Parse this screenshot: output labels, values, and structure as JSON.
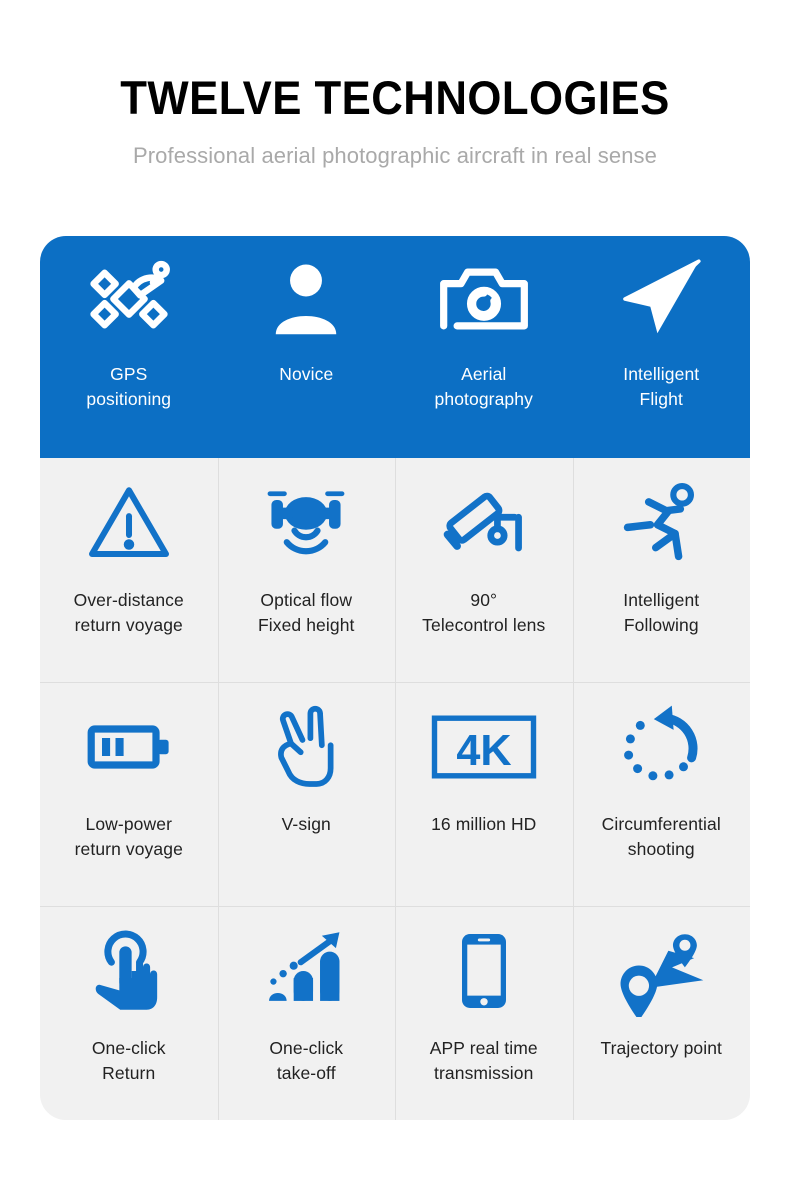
{
  "header": {
    "title": "TWELVE TECHNOLOGIES",
    "subtitle": "Professional aerial photographic aircraft in real sense"
  },
  "colors": {
    "accent_blue": "#0c6fc4",
    "icon_blue": "#1272c8",
    "cell_gray": "#f1f1f1",
    "divider": "#dedede",
    "title_black": "#000000",
    "subtitle_gray": "#a9a9a9",
    "label_dark": "#222222",
    "label_white": "#ffffff"
  },
  "features": [
    {
      "icon": "satellite-icon",
      "line1": "GPS",
      "line2": "positioning",
      "highlight": true
    },
    {
      "icon": "person-icon",
      "line1": "Novice",
      "line2": "",
      "highlight": true
    },
    {
      "icon": "camera-icon",
      "line1": "Aerial",
      "line2": "photography",
      "highlight": true
    },
    {
      "icon": "paper-plane-icon",
      "line1": "Intelligent",
      "line2": "Flight",
      "highlight": true
    },
    {
      "icon": "warning-triangle-icon",
      "line1": "Over-distance",
      "line2": "return voyage",
      "highlight": false
    },
    {
      "icon": "drone-sonar-icon",
      "line1": "Optical flow",
      "line2": "Fixed height",
      "highlight": false
    },
    {
      "icon": "security-camera-icon",
      "line1": "90°",
      "line2": "Telecontrol lens",
      "highlight": false
    },
    {
      "icon": "running-person-icon",
      "line1": "Intelligent",
      "line2": "Following",
      "highlight": false
    },
    {
      "icon": "battery-icon",
      "line1": "Low-power",
      "line2": "return voyage",
      "highlight": false
    },
    {
      "icon": "v-sign-hand-icon",
      "line1": "V-sign",
      "line2": "",
      "highlight": false
    },
    {
      "icon": "4k-badge-icon",
      "line1": "16 million HD",
      "line2": "",
      "highlight": false
    },
    {
      "icon": "circular-arrow-icon",
      "line1": "Circumferential",
      "line2": "shooting",
      "highlight": false
    },
    {
      "icon": "tap-hand-icon",
      "line1": "One-click",
      "line2": "Return",
      "highlight": false
    },
    {
      "icon": "ascending-bars-icon",
      "line1": "One-click",
      "line2": "take-off",
      "highlight": false
    },
    {
      "icon": "smartphone-icon",
      "line1": "APP real time",
      "line2": "transmission",
      "highlight": false
    },
    {
      "icon": "trajectory-route-icon",
      "line1": "Trajectory point",
      "line2": "",
      "highlight": false
    }
  ]
}
